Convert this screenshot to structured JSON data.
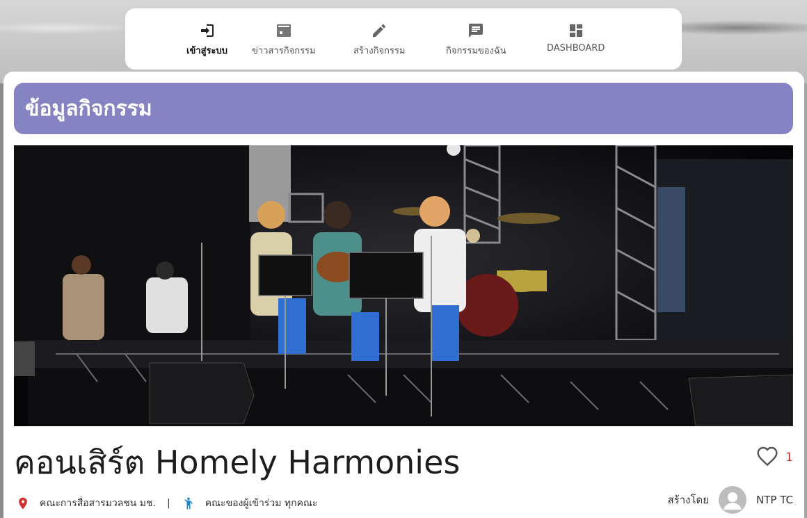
{
  "nav": {
    "items": [
      {
        "label": "เข้าสู่ระบบ",
        "icon": "login-icon",
        "active": true
      },
      {
        "label": "ข่าวสารกิจกรรม",
        "icon": "news-icon",
        "active": false
      },
      {
        "label": "สร้างกิจกรรม",
        "icon": "pencil-icon",
        "active": false
      },
      {
        "label": "กิจกรรมของฉัน",
        "icon": "message-icon",
        "active": false
      },
      {
        "label": "DASHBOARD",
        "icon": "dashboard-icon",
        "active": false
      }
    ]
  },
  "section": {
    "title": "ข้อมูลกิจกรรม",
    "color": "#8683c2"
  },
  "event": {
    "image_alt": "concert-stage-photo",
    "title": "คอนเสิร์ต Homely Harmonies",
    "likes": "1",
    "location": "คณะการสื่อสารมวลชน มช.",
    "participants": "คณะของผู้เข้าร่วม ทุกคณะ",
    "created_by_label": "สร้างโดย",
    "creator_name": "NTP TC"
  },
  "colors": {
    "accent": "#8683c2",
    "like": "#d32f2f",
    "location_pin": "#d32f2f",
    "person_icon": "#1e88c8"
  }
}
